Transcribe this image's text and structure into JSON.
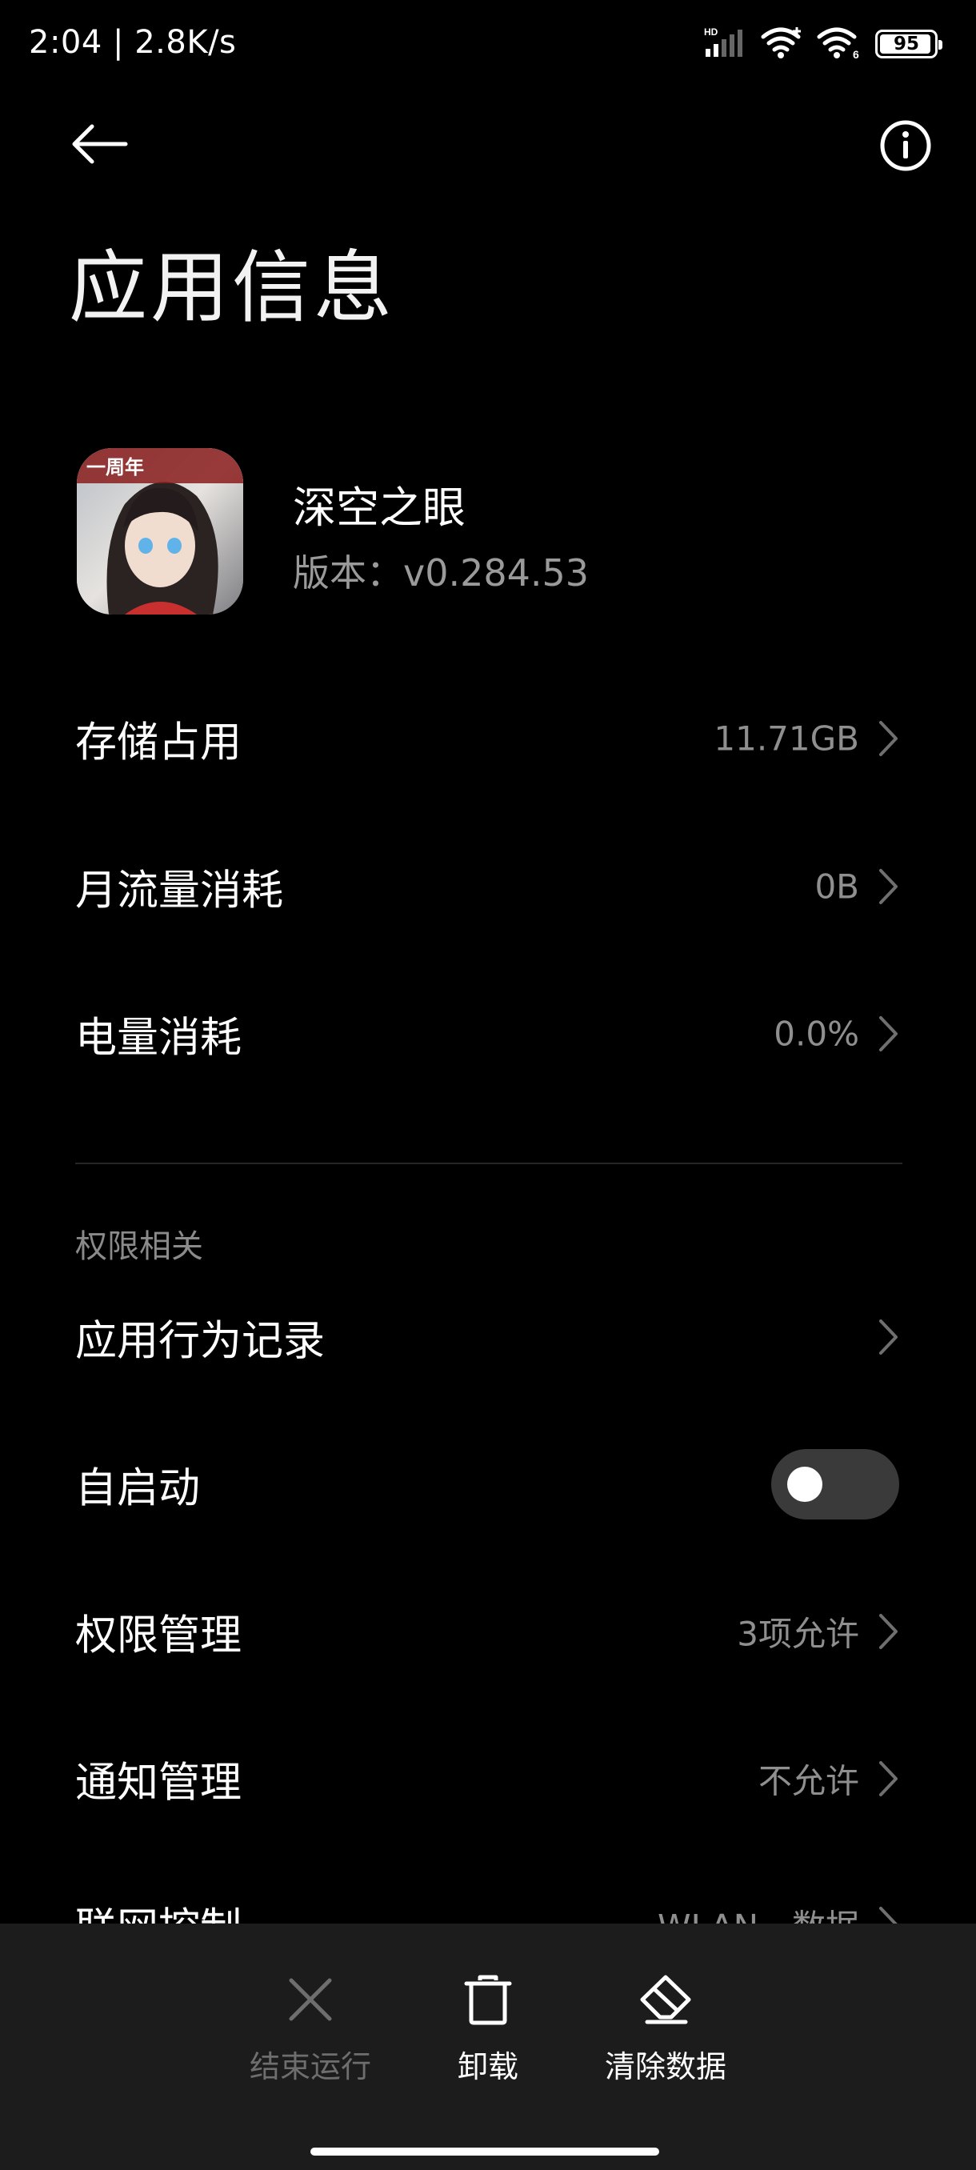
{
  "status_bar": {
    "time": "2:04 | 2.8K/s",
    "hd_label": "HD",
    "battery_level": "95",
    "battery_percent": 95,
    "wifi_badge": "6"
  },
  "header": {
    "title": "应用信息"
  },
  "app": {
    "name": "深空之眼",
    "version": "版本：v0.284.53",
    "icon_badge": "一周年"
  },
  "rows": {
    "storage": {
      "label": "存储占用",
      "value": "11.71GB"
    },
    "data_usage": {
      "label": "月流量消耗",
      "value": "0B"
    },
    "battery_usage": {
      "label": "电量消耗",
      "value": "0.0%"
    }
  },
  "permissions_section": {
    "header": "权限相关",
    "behavior_log": {
      "label": "应用行为记录"
    },
    "autostart": {
      "label": "自启动",
      "enabled": false
    },
    "permission_mgmt": {
      "label": "权限管理",
      "value": "3项允许"
    },
    "notification_mgmt": {
      "label": "通知管理",
      "value": "不允许"
    },
    "network_control": {
      "label": "联网控制",
      "value": "WLAN、数据"
    }
  },
  "bottom_actions": {
    "force_stop": {
      "label": "结束运行",
      "icon": "close-icon",
      "enabled": false
    },
    "uninstall": {
      "label": "卸载",
      "icon": "trash-icon",
      "enabled": true
    },
    "clear_data": {
      "label": "清除数据",
      "icon": "eraser-icon",
      "enabled": true
    }
  },
  "colors": {
    "background": "#000000",
    "bottom_bar": "#1c1c1c",
    "secondary_text": "#8f8f8f",
    "toggle_off": "#3a3a3a"
  }
}
